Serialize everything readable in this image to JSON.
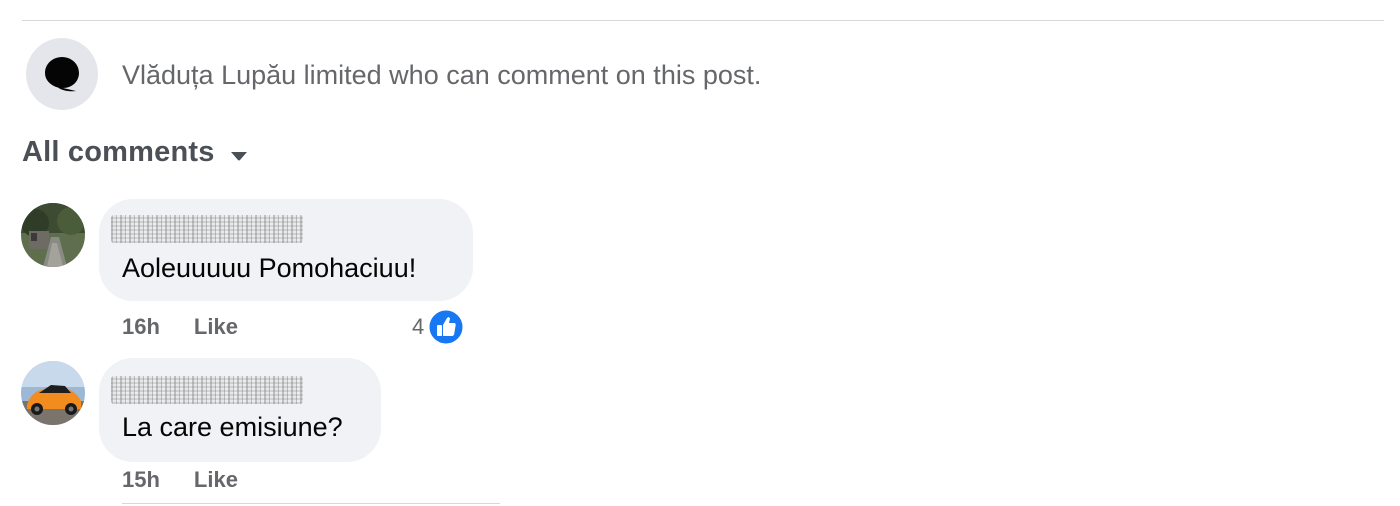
{
  "notice": {
    "text": "Vlăduța Lupău limited who can comment on this post.",
    "icon": "comment-restricted-icon"
  },
  "filter": {
    "label": "All comments",
    "icon": "caret-down-icon"
  },
  "comments": [
    {
      "author": "",
      "text": "Aoleuuuuu Pomohaciuu!",
      "time": "16h",
      "like_label": "Like",
      "reaction_count": "4",
      "reaction_icon": "like-reaction-icon"
    },
    {
      "author": "",
      "text": "La care emisiune?",
      "time": "15h",
      "like_label": "Like"
    }
  ],
  "colors": {
    "bubble": "#f0f2f5",
    "secondary_text": "#65676b",
    "like_blue": "#1877f2"
  }
}
